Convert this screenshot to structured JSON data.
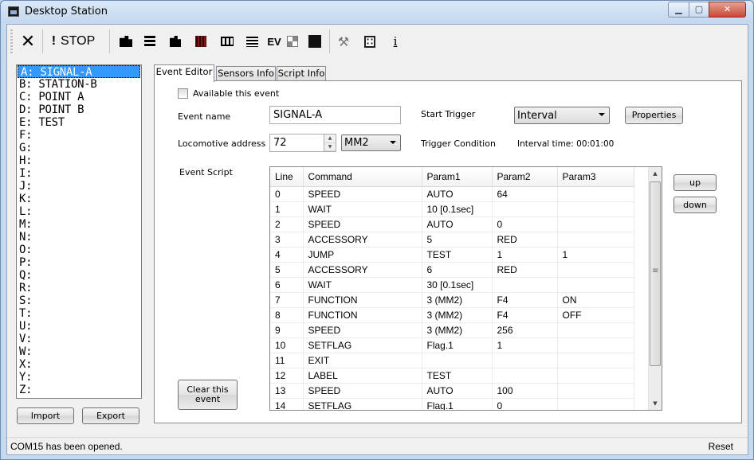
{
  "window": {
    "title": "Desktop Station",
    "min_glyph": "▁",
    "max_glyph": "▢",
    "close_glyph": "✕"
  },
  "toolbar": {
    "close_glyph": "✕",
    "stop_bang": "!",
    "stop_label": "STOP",
    "ev_label": "EV",
    "hammer_glyph": "⚒",
    "info_glyph": "i",
    "icons": [
      "close-icon",
      "stop-icon",
      "locomotive-icon",
      "stack-icon",
      "loco-throttle-icon",
      "layout-grid-icon",
      "rail-icon",
      "list-icon",
      "event-icon",
      "quad-icon",
      "ps-icon",
      "hammer-icon",
      "calculator-icon",
      "info-icon"
    ]
  },
  "event_list": {
    "items": [
      "A: SIGNAL-A",
      "B: STATION-B",
      "C: POINT A",
      "D: POINT B",
      "E: TEST",
      "F:",
      "G:",
      "H:",
      "I:",
      "J:",
      "K:",
      "L:",
      "M:",
      "N:",
      "O:",
      "P:",
      "Q:",
      "R:",
      "S:",
      "T:",
      "U:",
      "V:",
      "W:",
      "X:",
      "Y:",
      "Z:"
    ],
    "selected": "A: SIGNAL-A"
  },
  "buttons": {
    "import": "Import",
    "export": "Export",
    "clear_line1": "Clear this",
    "clear_line2": "event",
    "properties": "Properties",
    "up": "up",
    "down": "down"
  },
  "tabs": [
    "Event Editor",
    "Sensors Info",
    "Script Info"
  ],
  "editor": {
    "available_label": "Available this event",
    "event_name_label": "Event name",
    "event_name_value": "SIGNAL-A",
    "loco_address_label": "Locomotive address",
    "loco_address_value": "72",
    "protocol_value": "MM2",
    "start_trigger_label": "Start Trigger",
    "start_trigger_value": "Interval",
    "trigger_condition_label": "Trigger Condition",
    "trigger_condition_value": "Interval time: 00:01:00",
    "event_script_label": "Event Script"
  },
  "script": {
    "columns": [
      "Line",
      "Command",
      "Param1",
      "Param2",
      "Param3"
    ],
    "rows": [
      [
        "0",
        "SPEED",
        "AUTO",
        "64",
        ""
      ],
      [
        "1",
        "WAIT",
        "10 [0.1sec]",
        "",
        ""
      ],
      [
        "2",
        "SPEED",
        "AUTO",
        "0",
        ""
      ],
      [
        "3",
        "ACCESSORY",
        "5",
        "RED",
        ""
      ],
      [
        "4",
        "JUMP",
        "TEST",
        "1",
        "1"
      ],
      [
        "5",
        "ACCESSORY",
        "6",
        "RED",
        ""
      ],
      [
        "6",
        "WAIT",
        "30 [0.1sec]",
        "",
        ""
      ],
      [
        "7",
        "FUNCTION",
        "3 (MM2)",
        "F4",
        "ON"
      ],
      [
        "8",
        "FUNCTION",
        "3 (MM2)",
        "F4",
        "OFF"
      ],
      [
        "9",
        "SPEED",
        "3 (MM2)",
        "256",
        ""
      ],
      [
        "10",
        "SETFLAG",
        "Flag.1",
        "1",
        ""
      ],
      [
        "11",
        "EXIT",
        "",
        "",
        ""
      ],
      [
        "12",
        "LABEL",
        "TEST",
        "",
        ""
      ],
      [
        "13",
        "SPEED",
        "AUTO",
        "100",
        ""
      ],
      [
        "14",
        "SETFLAG",
        "Flag.1",
        "0",
        ""
      ]
    ],
    "scroll_up_glyph": "▲",
    "scroll_down_glyph": "▼"
  },
  "status": {
    "message": "COM15 has been opened.",
    "reset": "Reset"
  }
}
